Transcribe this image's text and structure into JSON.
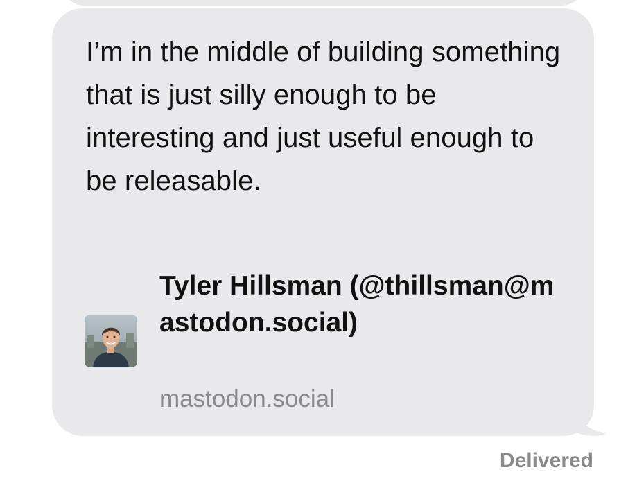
{
  "message": {
    "text": "I’m in the middle of building something that is just silly enough to be interesting and just useful enough to be releasable."
  },
  "link_preview": {
    "title": "Tyler Hillsman (@thillsman@mastodon.social)",
    "domain": "mastodon.social",
    "avatar_icon": "profile-photo"
  },
  "status": {
    "label": "Delivered"
  },
  "colors": {
    "bubble": "#e9e9eb",
    "text": "#111111",
    "secondary_text": "#8a8a8e",
    "background": "#ffffff"
  }
}
